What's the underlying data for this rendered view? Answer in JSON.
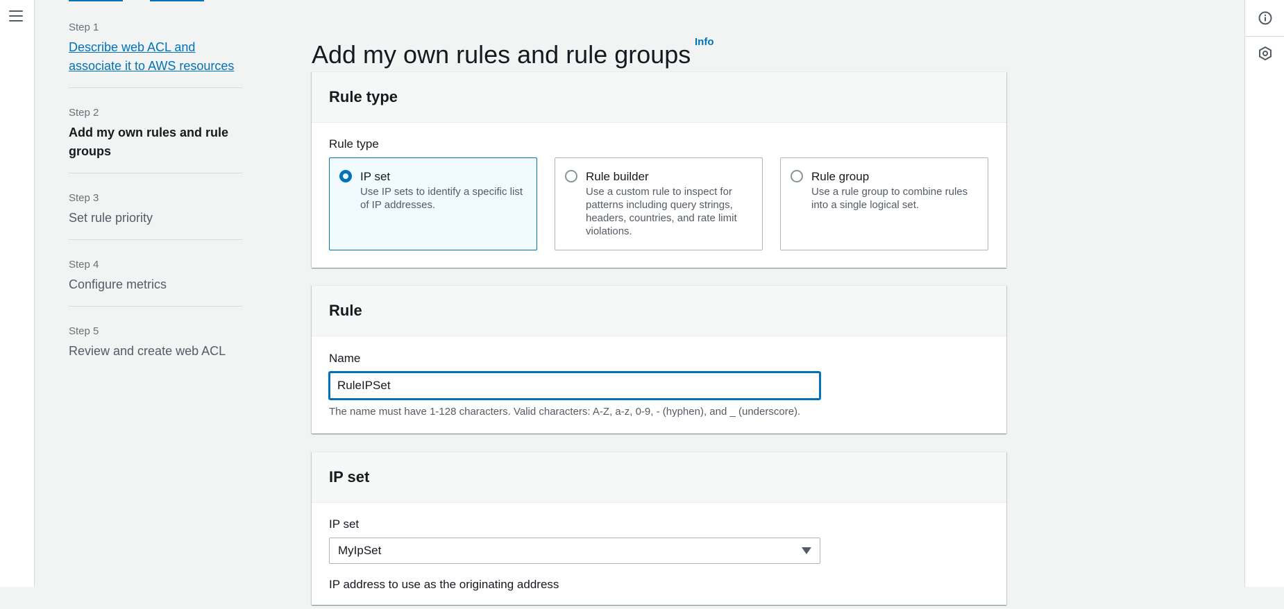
{
  "steps": [
    {
      "num": "Step 1",
      "title": "Describe web ACL and associate it to AWS resources",
      "state": "link"
    },
    {
      "num": "Step 2",
      "title": "Add my own rules and rule groups",
      "state": "active"
    },
    {
      "num": "Step 3",
      "title": "Set rule priority",
      "state": "pending"
    },
    {
      "num": "Step 4",
      "title": "Configure metrics",
      "state": "pending"
    },
    {
      "num": "Step 5",
      "title": "Review and create web ACL",
      "state": "pending"
    }
  ],
  "page": {
    "title": "Add my own rules and rule groups",
    "info_label": "Info"
  },
  "rule_type_panel": {
    "heading": "Rule type",
    "field_label": "Rule type",
    "options": [
      {
        "title": "IP set",
        "description": "Use IP sets to identify a specific list of IP addresses.",
        "selected": true
      },
      {
        "title": "Rule builder",
        "description": "Use a custom rule to inspect for patterns including query strings, headers, countries, and rate limit violations.",
        "selected": false
      },
      {
        "title": "Rule group",
        "description": "Use a rule group to combine rules into a single logical set.",
        "selected": false
      }
    ]
  },
  "rule_panel": {
    "heading": "Rule",
    "name_label": "Name",
    "name_value": "RuleIPSet",
    "name_hint": "The name must have 1-128 characters. Valid characters: A-Z, a-z, 0-9, - (hyphen), and _ (underscore)."
  },
  "ip_set_panel": {
    "heading": "IP set",
    "field_label": "IP set",
    "selected_value": "MyIpSet",
    "next_label_cut": "IP address to use as the originating address"
  },
  "icons": {
    "menu": "hamburger-menu-icon",
    "info": "info-circle-icon",
    "settings": "hexagon-settings-icon"
  },
  "colors": {
    "accent": "#0073bb",
    "selected_tile_bg": "#f1faff",
    "page_bg": "#f2f3f3"
  }
}
